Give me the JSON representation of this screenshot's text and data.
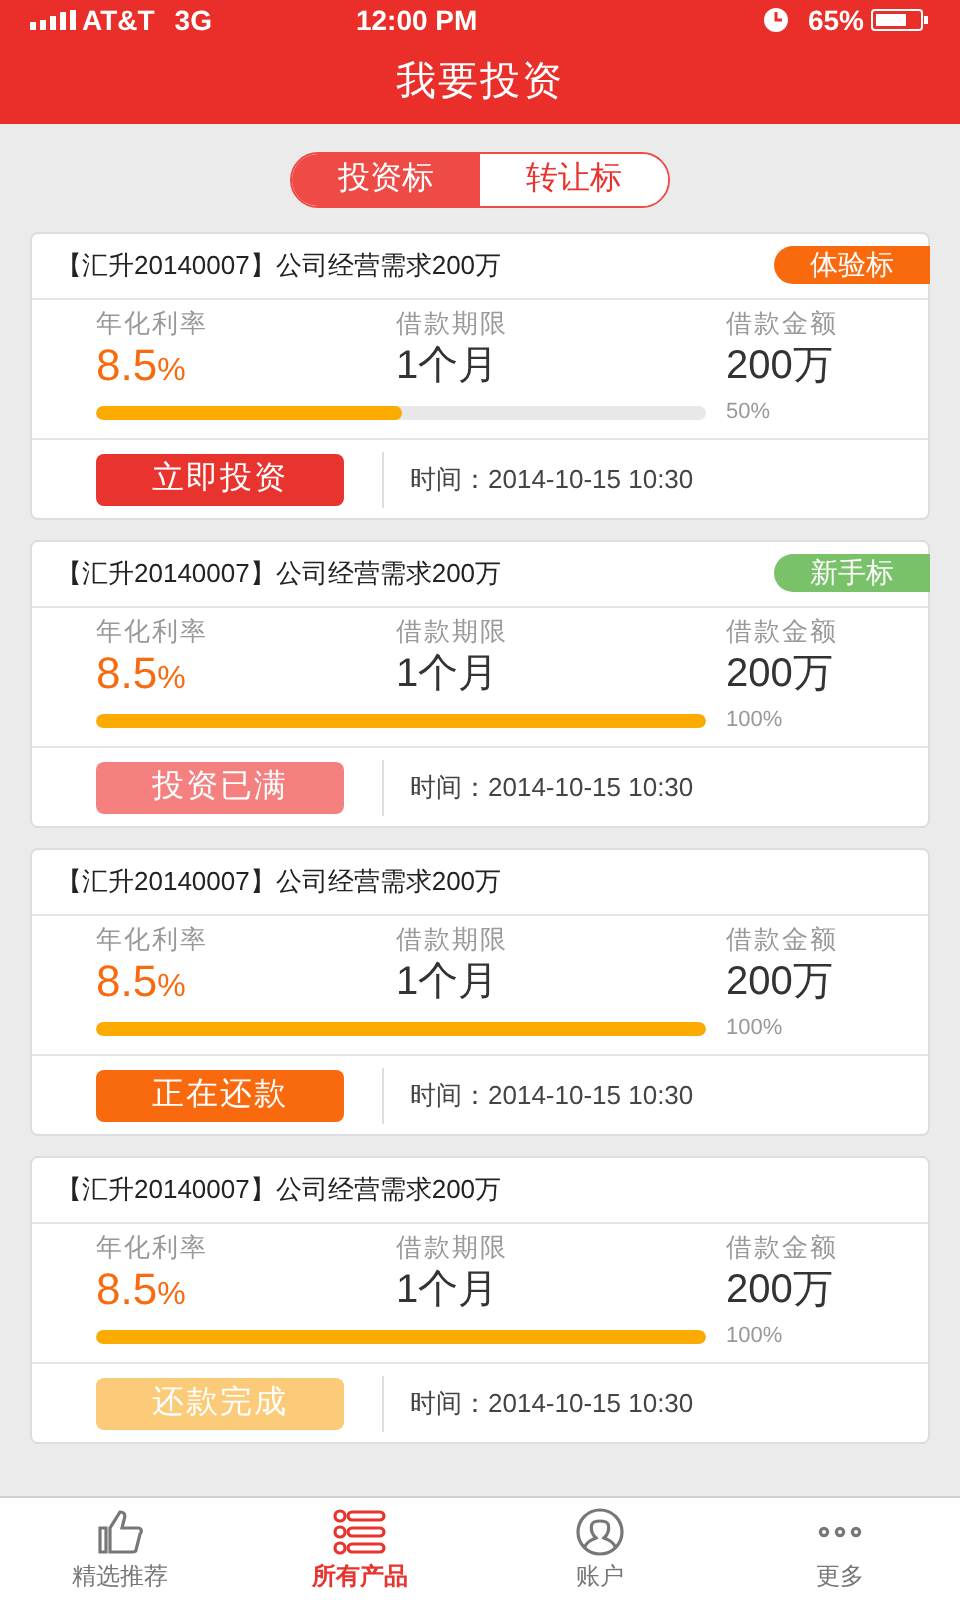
{
  "status_bar": {
    "carrier": "AT&T",
    "network": "3G",
    "time": "12:00 PM",
    "battery": "65%"
  },
  "title": "我要投资",
  "tabs": [
    {
      "label": "投资标",
      "selected": true
    },
    {
      "label": "转让标",
      "selected": false
    }
  ],
  "loans": [
    {
      "title": "【汇升20140007】公司经营需求200万",
      "tag": {
        "label": "体验标",
        "color": "#f96a0e"
      },
      "rate_label": "年化利率",
      "rate": "8.5",
      "rate_unit": "%",
      "term_label": "借款期限",
      "term": "1个月",
      "amount_label": "借款金额",
      "amount": "200万",
      "level": 0.5,
      "percent": "50%",
      "action": {
        "label": "立即投资",
        "color": "#e8332f"
      },
      "time": "时间：2014-10-15 10:30"
    },
    {
      "title": "【汇升20140007】公司经营需求200万",
      "tag": {
        "label": "新手标",
        "color": "#7ac26a"
      },
      "rate_label": "年化利率",
      "rate": "8.5",
      "rate_unit": "%",
      "term_label": "借款期限",
      "term": "1个月",
      "amount_label": "借款金额",
      "amount": "200万",
      "level": 1,
      "percent": "100%",
      "action": {
        "label": "投资已满",
        "color": "#f58080"
      },
      "time": "时间：2014-10-15 10:30"
    },
    {
      "title": "【汇升20140007】公司经营需求200万",
      "rate_label": "年化利率",
      "rate": "8.5",
      "rate_unit": "%",
      "term_label": "借款期限",
      "term": "1个月",
      "amount_label": "借款金额",
      "amount": "200万",
      "level": 1,
      "percent": "100%",
      "action": {
        "label": "正在还款",
        "color": "#f96a0e"
      },
      "time": "时间：2014-10-15 10:30"
    },
    {
      "title": "【汇升20140007】公司经营需求200万",
      "rate_label": "年化利率",
      "rate": "8.5",
      "rate_unit": "%",
      "term_label": "借款期限",
      "term": "1个月",
      "amount_label": "借款金额",
      "amount": "200万",
      "level": 1,
      "percent": "100%",
      "action": {
        "label": "还款完成",
        "color": "#fccb7a"
      },
      "time": "时间：2014-10-15 10:30"
    }
  ],
  "nav": [
    {
      "label": "精选推荐",
      "selected": false,
      "kind": "thumb"
    },
    {
      "label": "所有产品",
      "selected": true,
      "kind": "list"
    },
    {
      "label": "账户",
      "selected": false,
      "kind": "user"
    },
    {
      "label": "更多",
      "selected": false,
      "kind": "more"
    }
  ]
}
